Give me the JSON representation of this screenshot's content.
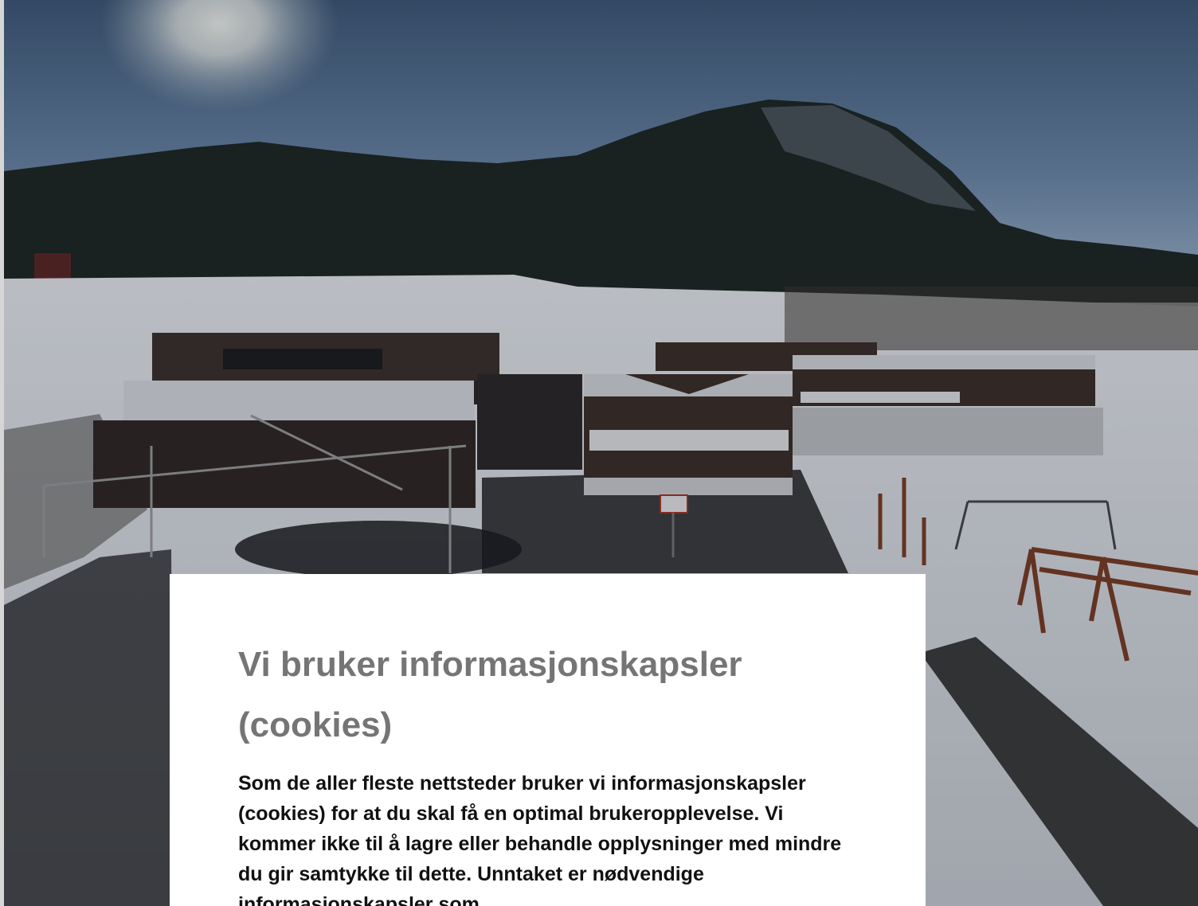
{
  "hero_image": {
    "alt_icon": "school-aerial-photo"
  },
  "cookie_dialog": {
    "title": "Vi bruker informasjonskapsler (cookies)",
    "body": "Som de aller fleste nettsteder bruker vi informasjonskapsler (cookies) for at du skal få en optimal brukeropplevelse. Vi kommer ikke til å lagre eller behandle opplysninger med mindre du gir samtykke til dette. Unntaket er nødvendige informasjonskapsler som"
  },
  "colors": {
    "title": "#757575",
    "body": "#111111",
    "dialog_bg": "#ffffff"
  }
}
